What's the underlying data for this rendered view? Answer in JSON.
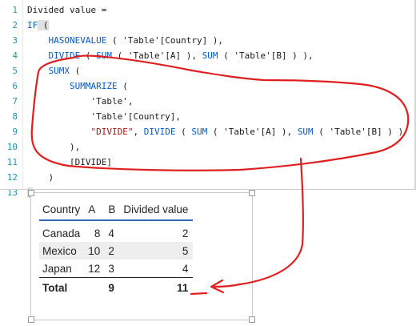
{
  "editor": {
    "lines": [
      {
        "num": "1",
        "segments": [
          {
            "t": "Divided value =",
            "c": "plain"
          }
        ]
      },
      {
        "num": "2",
        "segments": [
          {
            "t": "IF",
            "c": "kw"
          },
          {
            "t": " (",
            "c": "hl"
          }
        ]
      },
      {
        "num": "3",
        "segments": [
          {
            "t": "    ",
            "c": "plain"
          },
          {
            "t": "HASONEVALUE",
            "c": "kw"
          },
          {
            "t": " ( 'Table'[Country] ),",
            "c": "plain"
          }
        ]
      },
      {
        "num": "4",
        "segments": [
          {
            "t": "    ",
            "c": "plain"
          },
          {
            "t": "DIVIDE",
            "c": "kw"
          },
          {
            "t": " ( ",
            "c": "plain"
          },
          {
            "t": "SUM",
            "c": "kw"
          },
          {
            "t": " ( 'Table'[A] ), ",
            "c": "plain"
          },
          {
            "t": "SUM",
            "c": "kw"
          },
          {
            "t": " ( 'Table'[B] ) ),",
            "c": "plain"
          }
        ]
      },
      {
        "num": "5",
        "segments": [
          {
            "t": "    ",
            "c": "plain"
          },
          {
            "t": "SUMX",
            "c": "kw"
          },
          {
            "t": " (",
            "c": "plain"
          }
        ]
      },
      {
        "num": "6",
        "segments": [
          {
            "t": "        ",
            "c": "plain"
          },
          {
            "t": "SUMMARIZE",
            "c": "kw"
          },
          {
            "t": " (",
            "c": "plain"
          }
        ]
      },
      {
        "num": "7",
        "segments": [
          {
            "t": "            'Table',",
            "c": "plain"
          }
        ]
      },
      {
        "num": "8",
        "segments": [
          {
            "t": "            'Table'[Country],",
            "c": "plain"
          }
        ]
      },
      {
        "num": "9",
        "segments": [
          {
            "t": "            ",
            "c": "plain"
          },
          {
            "t": "\"DIVIDE\"",
            "c": "str"
          },
          {
            "t": ", ",
            "c": "plain"
          },
          {
            "t": "DIVIDE",
            "c": "kw"
          },
          {
            "t": " ( ",
            "c": "plain"
          },
          {
            "t": "SUM",
            "c": "kw"
          },
          {
            "t": " ( 'Table'[A] ), ",
            "c": "plain"
          },
          {
            "t": "SUM",
            "c": "kw"
          },
          {
            "t": " ( 'Table'[B] ) )",
            "c": "plain"
          }
        ]
      },
      {
        "num": "10",
        "segments": [
          {
            "t": "        ),",
            "c": "plain"
          }
        ]
      },
      {
        "num": "11",
        "segments": [
          {
            "t": "        [DIVIDE]",
            "c": "plain"
          }
        ]
      },
      {
        "num": "12",
        "segments": [
          {
            "t": "    )",
            "c": "plain"
          }
        ]
      },
      {
        "num": "13",
        "segments": [
          {
            "t": ")",
            "c": "hl"
          }
        ]
      }
    ]
  },
  "table": {
    "headers": [
      "Country",
      "A",
      "B",
      "Divided value"
    ],
    "rows": [
      {
        "country": "Canada",
        "a": "8",
        "b": "4",
        "divided": "2"
      },
      {
        "country": "Mexico",
        "a": "10",
        "b": "2",
        "divided": "5"
      },
      {
        "country": "Japan",
        "a": "12",
        "b": "3",
        "divided": "4"
      }
    ],
    "total": {
      "label": "Total",
      "a": "",
      "b": "9",
      "divided": "11"
    }
  },
  "colors": {
    "keyword": "#035aca",
    "string": "#a31515",
    "line_number": "#2b91af",
    "header_underline": "#2f67b5",
    "annotation": "#e02020"
  }
}
